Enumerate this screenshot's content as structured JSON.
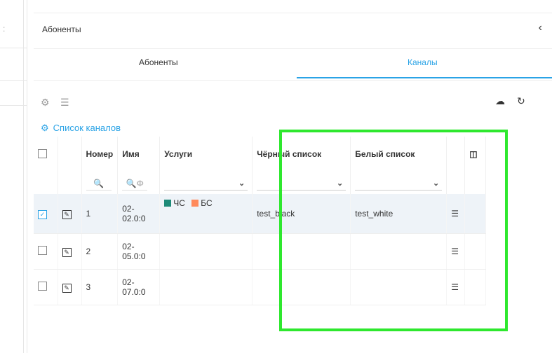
{
  "header": {
    "title": "Абоненты",
    "back_icon": "chevron-left-icon"
  },
  "tabs": [
    {
      "label": "Абоненты",
      "active": false
    },
    {
      "label": "Каналы",
      "active": true
    }
  ],
  "toolbar": {
    "icons": [
      "settings-icon",
      "filter-clear-icon",
      "cloud-upload-icon",
      "refresh-icon"
    ]
  },
  "list_title": "Список каналов",
  "columns": {
    "number": "Номер",
    "name": "Имя",
    "services": "Услуги",
    "blacklist": "Чёрный список",
    "whitelist": "Белый список"
  },
  "filter_glyph": "🔍",
  "filter_glyph_phi": "🔍Φ",
  "rows": [
    {
      "number": "1",
      "name": "02-02.0:0",
      "tag1": "ЧС",
      "tag2": "БС",
      "black": "test_black",
      "white": "test_white"
    },
    {
      "number": "2",
      "name": "02-05.0:0",
      "tag1": "",
      "tag2": "",
      "black": "",
      "white": ""
    },
    {
      "number": "3",
      "name": "02-07.0:0",
      "tag1": "",
      "tag2": "",
      "black": "",
      "white": ""
    }
  ],
  "colors": {
    "accent": "#2aa3e6",
    "tag_black": "#1d8a78",
    "tag_white": "#ff8a5c",
    "highlight": "#2ee82e"
  }
}
